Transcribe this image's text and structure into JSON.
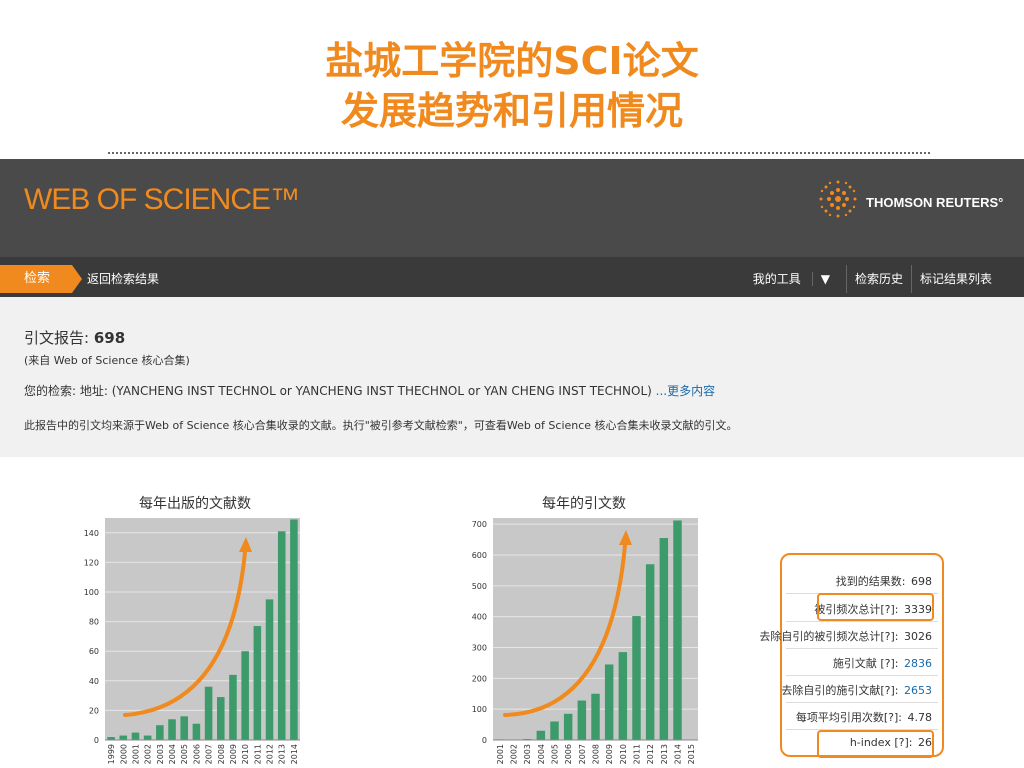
{
  "slide": {
    "title_line1": "盐城工学院的SCI论文",
    "title_line2": "发展趋势和引用情况"
  },
  "header": {
    "logo": "WEB OF SCIENCE™",
    "brand": "THOMSON REUTERS°"
  },
  "nav": {
    "search": "检索",
    "back": "返回检索结果",
    "my_tools": "我的工具",
    "history": "检索历史",
    "marked_list": "标记结果列表"
  },
  "report": {
    "title_label": "引文报告:",
    "title_value": "698",
    "source": "(来自 Web of Science 核心合集)",
    "query_label": "您的检索:",
    "query": "地址: (YANCHENG INST TECHNOL or YANCHENG INST THECHNOL or YAN CHENG INST TECHNOL)",
    "more": "...更多内容",
    "note": "此报告中的引文均来源于Web of Science 核心合集收录的文献。执行\"被引参考文献检索\"，可查看Web of Science 核心合集未收录文献的引文。"
  },
  "stats": [
    {
      "label": "找到的结果数:",
      "value": "698"
    },
    {
      "label": "被引频次总计[?]:",
      "value": "3339"
    },
    {
      "label": "去除自引的被引频次总计[?]:",
      "value": "3026"
    },
    {
      "label": "施引文献 [?]:",
      "value": "2836"
    },
    {
      "label": "去除自引的施引文献[?]:",
      "value": "2653"
    },
    {
      "label": "每项平均引用次数[?]:",
      "value": "4.78"
    },
    {
      "label": "h-index [?]:",
      "value": "26"
    }
  ],
  "colors": {
    "accent": "#f08a1e",
    "bar": "#3d9a6a",
    "plot_bg": "#c8c8c8"
  },
  "chart_data": [
    {
      "type": "bar",
      "title": "每年出版的文献数",
      "categories": [
        "1999",
        "2000",
        "2001",
        "2002",
        "2003",
        "2004",
        "2005",
        "2006",
        "2007",
        "2008",
        "2009",
        "2010",
        "2011",
        "2012",
        "2013",
        "2014"
      ],
      "values": [
        2,
        3,
        5,
        3,
        10,
        14,
        16,
        11,
        36,
        29,
        44,
        60,
        77,
        95,
        141,
        149
      ],
      "ylim": [
        0,
        150
      ],
      "yticks": [
        0,
        20,
        40,
        60,
        80,
        100,
        120,
        140
      ],
      "grid": true
    },
    {
      "type": "bar",
      "title": "每年的引文数",
      "categories": [
        "2001",
        "2002",
        "2003",
        "2004",
        "2005",
        "2006",
        "2007",
        "2008",
        "2009",
        "2010",
        "2011",
        "2012",
        "2013",
        "2014",
        "2015"
      ],
      "values": [
        2,
        0,
        3,
        30,
        60,
        85,
        128,
        150,
        245,
        285,
        402,
        570,
        655,
        712,
        0
      ],
      "ylim": [
        0,
        720
      ],
      "yticks": [
        0,
        100,
        200,
        300,
        400,
        500,
        600,
        700
      ],
      "grid": true
    }
  ]
}
